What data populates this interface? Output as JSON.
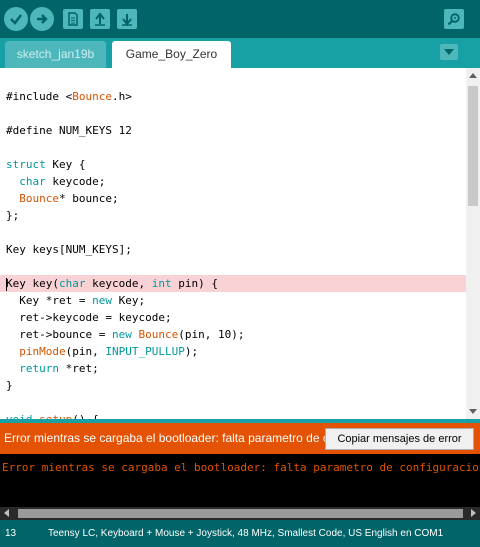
{
  "toolbar": {
    "buttons": [
      {
        "name": "verify-button",
        "icon": "checkmark-icon"
      },
      {
        "name": "upload-button",
        "icon": "arrow-right-icon"
      },
      {
        "name": "new-button",
        "icon": "document-icon"
      },
      {
        "name": "open-button",
        "icon": "arrow-up-icon"
      },
      {
        "name": "save-button",
        "icon": "arrow-down-icon"
      },
      {
        "name": "serial-monitor-button",
        "icon": "magnifier-icon"
      }
    ]
  },
  "tabs": [
    {
      "label": "sketch_jan19b",
      "active": false
    },
    {
      "label": "Game_Boy_Zero",
      "active": true
    }
  ],
  "editor": {
    "lines": [
      "#include <Bounce.h>",
      "",
      "#define NUM_KEYS 12",
      "",
      "struct Key {",
      "  char keycode;",
      "  Bounce* bounce;",
      "};",
      "",
      "Key keys[NUM_KEYS];",
      "",
      "Key key(char keycode, int pin) {",
      "  Key *ret = new Key;",
      "  ret->keycode = keycode;",
      "  ret->bounce = new Bounce(pin, 10);",
      "  pinMode(pin, INPUT_PULLUP);",
      "  return *ret;",
      "}",
      "",
      "void setup() {"
    ],
    "highlighted_line": 12
  },
  "error_bar": {
    "message": "Error mientras se cargaba el bootloader: falta parametro de configuracion",
    "copy_button": "Copiar mensajes de error"
  },
  "console": {
    "output": "Error mientras se cargaba el bootloader: falta parametro de configuracion"
  },
  "status": {
    "line_number": "13",
    "board": "Teensy LC, Keyboard + Mouse + Joystick, 48 MHz, Smallest Code, US English en COM1"
  },
  "colors": {
    "toolbar": "#006468",
    "tabbar": "#17a1a5",
    "error": "#e35205",
    "highlight": "#f8d2d4"
  }
}
